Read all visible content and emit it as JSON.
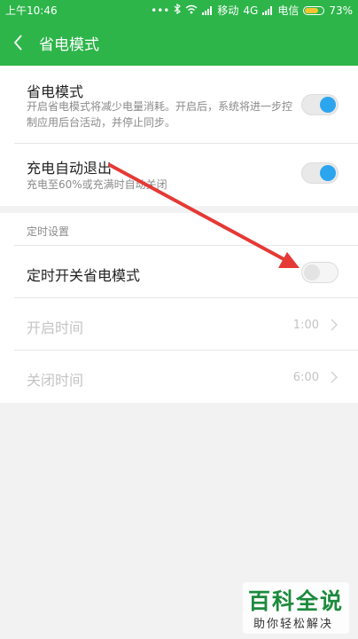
{
  "status_bar": {
    "time": "上午10:46",
    "icons": [
      "more-dots-icon",
      "bluetooth-icon",
      "wifi-icon",
      "signal-icon",
      "signal-icon",
      "battery-icon"
    ],
    "carrier1": "移动",
    "network": "4G",
    "carrier2": "电信",
    "battery_percent": "73%",
    "battery_level": 0.73
  },
  "toolbar": {
    "back_icon": "chevron-left-icon",
    "title": "省电模式"
  },
  "settings": {
    "power_saving": {
      "title": "省电模式",
      "description": "开启省电模式将减少电量消耗。开启后，系统将进一步控制应用后台活动，并停止同步。",
      "enabled": true
    },
    "auto_exit": {
      "title": "充电自动退出",
      "description": "充电至60%或充满时自动关闭",
      "enabled": true
    }
  },
  "schedule": {
    "section_title": "定时设置",
    "toggle": {
      "title": "定时开关省电模式",
      "enabled": false
    },
    "start_time": {
      "label": "开启时间",
      "value": "1:00"
    },
    "end_time": {
      "label": "关闭时间",
      "value": "6:00"
    }
  },
  "colors": {
    "accent_green": "#2db54a",
    "switch_blue": "#2ca5ef",
    "annotation_red": "#e53935"
  },
  "watermark": {
    "main": "百科全说",
    "sub": "助你轻松解决"
  }
}
